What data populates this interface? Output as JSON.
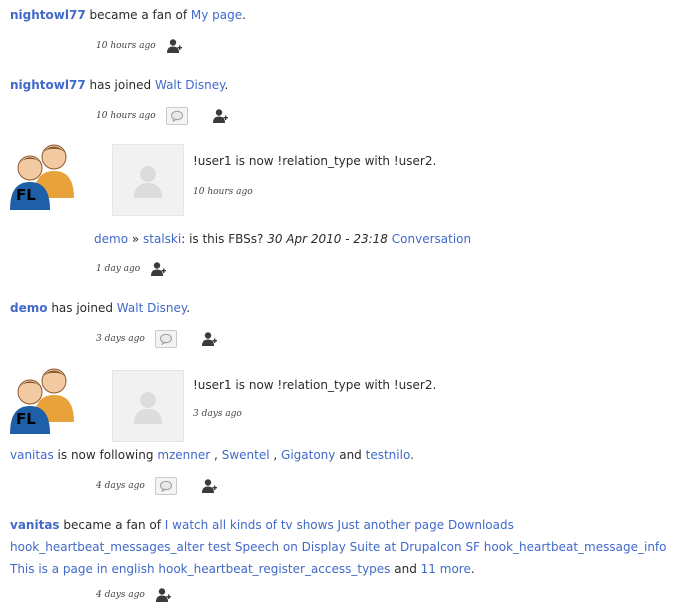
{
  "items": [
    {
      "user": "nightowl77",
      "verb": "became a fan of",
      "target": "My page",
      "suffix": ".",
      "time": "10 hours ago"
    },
    {
      "user": "nightowl77",
      "verb": "has joined",
      "target": "Walt Disney",
      "suffix": ".",
      "time": "10 hours ago"
    },
    {
      "avatar_initials": "FL",
      "text": "!user1 is now !relation_type with !user2.",
      "time": "10 hours ago"
    },
    {
      "from": "demo",
      "arrow": "»",
      "to": "stalski",
      "text": ": is this FBSs?",
      "date": "30 Apr 2010 - 23:18",
      "link": "Conversation",
      "time": "1 day ago"
    },
    {
      "user": "demo",
      "verb": "has joined",
      "target": "Walt Disney",
      "suffix": ".",
      "time": "3 days ago"
    },
    {
      "avatar_initials": "FL",
      "text": "!user1 is now !relation_type with !user2.",
      "time": "3 days ago"
    },
    {
      "user": "vanitas",
      "verb": "is now following",
      "targets": [
        "mzenner",
        "Swentel",
        "Gigatony"
      ],
      "sep": ",",
      "and": "and",
      "last_target": "testnilo",
      "suffix": ".",
      "time": "4 days ago"
    },
    {
      "user": "vanitas",
      "verb": "became a fan of",
      "targets_text": "I watch all kinds of tv shows Just another page Downloads hook_heartbeat_messages_alter test Speech on Display Suite at Drupalcon SF hook_heartbeat_message_info This is a page in english hook_heartbeat_register_access_types",
      "and": "and",
      "more": "11 more",
      "suffix": ".",
      "time": "4 days ago"
    }
  ],
  "icons": {
    "add_user": "add-user-icon",
    "comment": "comment-icon",
    "avatar_group": "friends-group-icon",
    "avatar_placeholder": "avatar-placeholder-icon"
  },
  "colors": {
    "username": "#3a7d1a",
    "link": "#4169c9",
    "avatar_blue": "#1f5fa8",
    "avatar_orange": "#e8a23a"
  }
}
